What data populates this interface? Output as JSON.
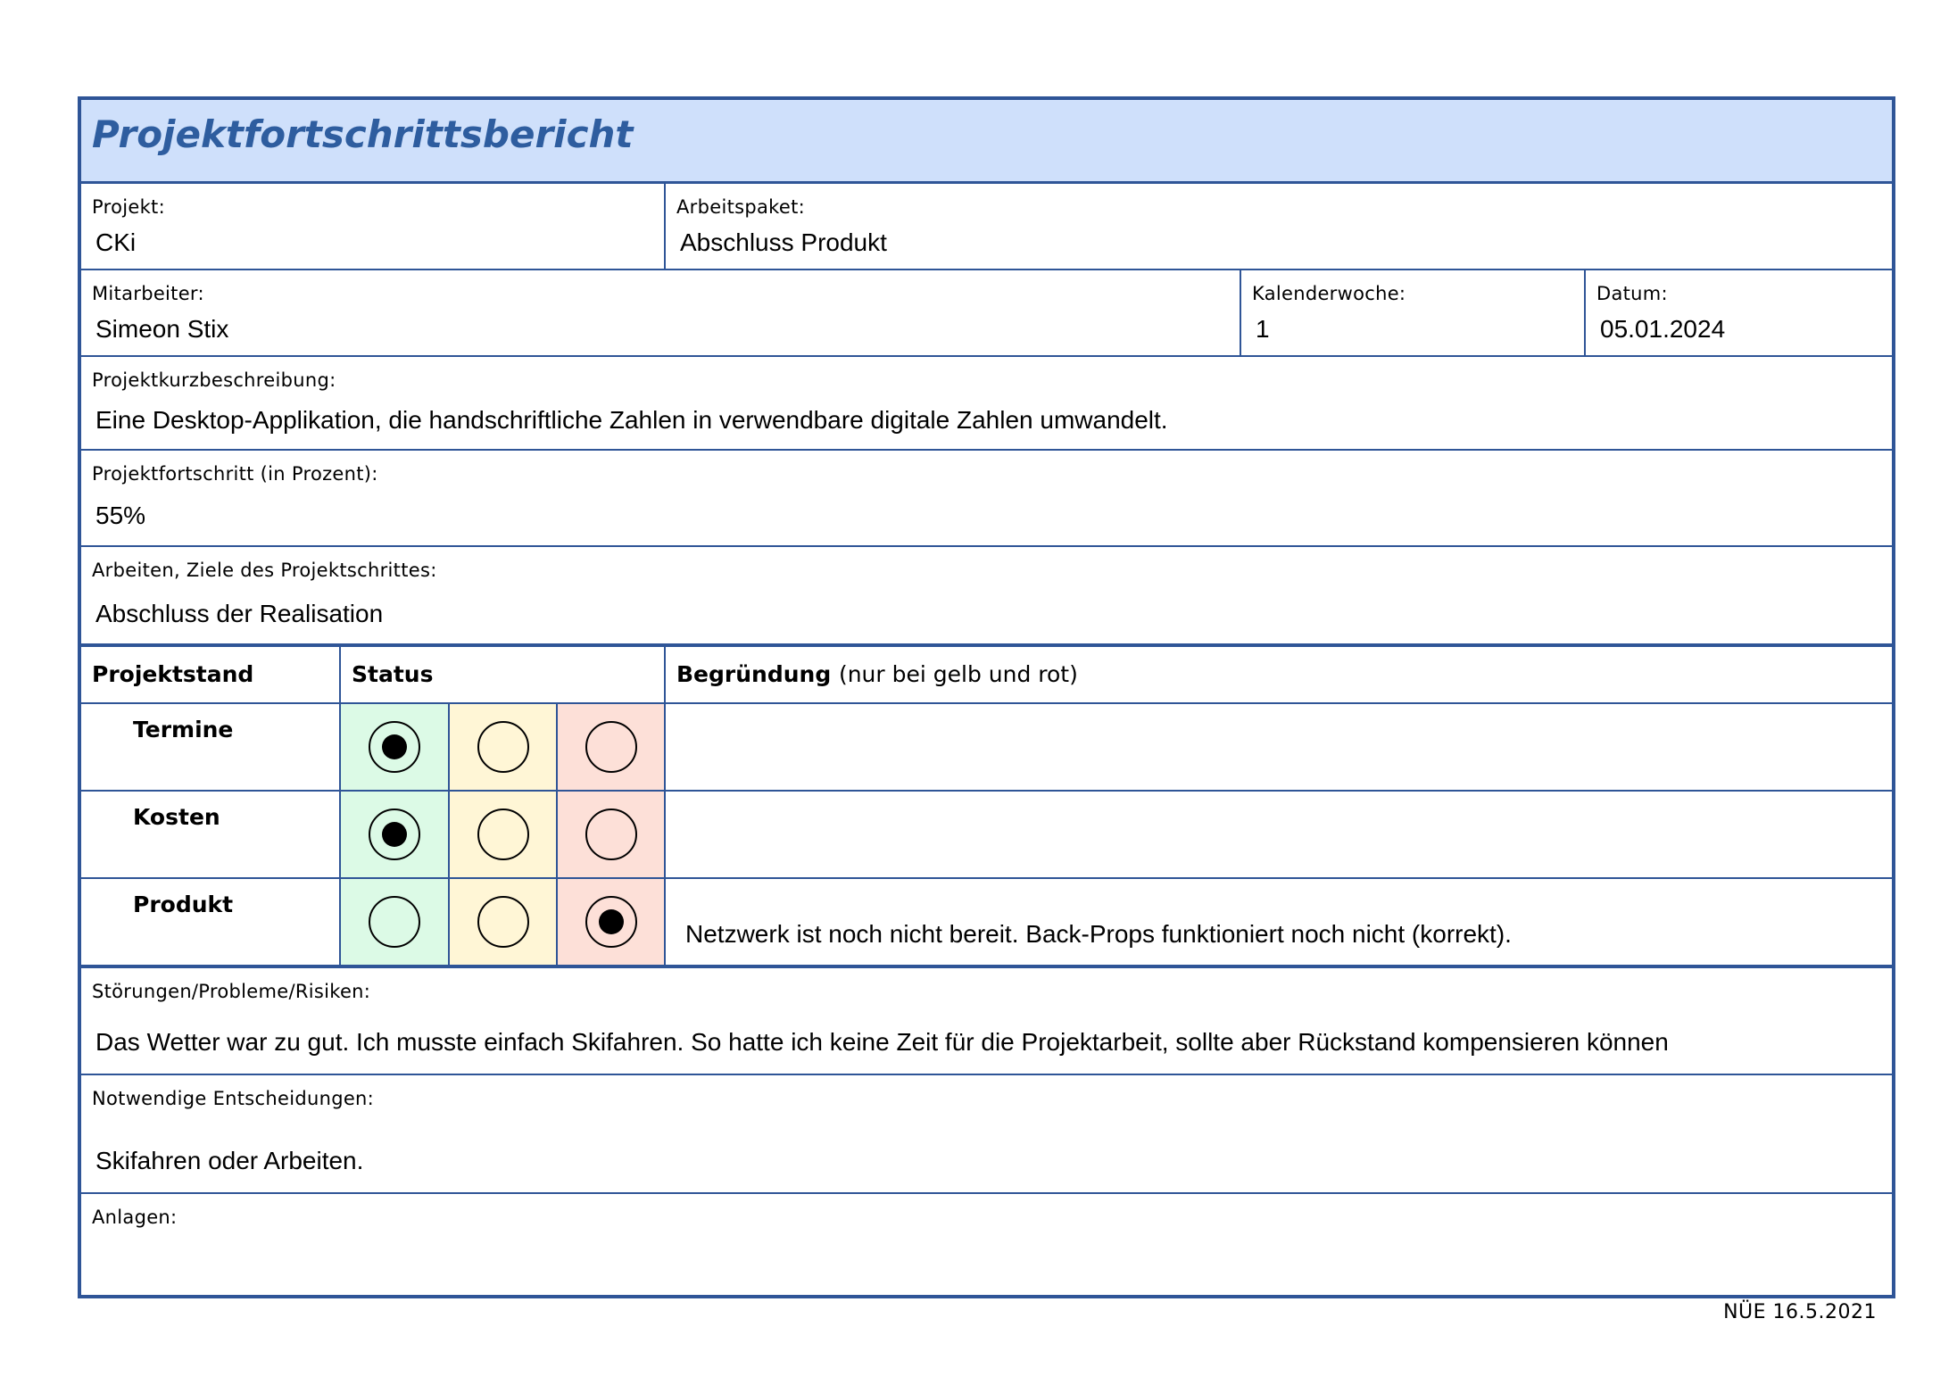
{
  "title": "Projektfortschrittsbericht",
  "colors": {
    "border": "#2f5597",
    "title_bg": "#cfe0fb",
    "title_text": "#2e5d9f",
    "green": "#dcfae6",
    "yellow": "#fff6d6",
    "red": "#fde0d8"
  },
  "projekt": {
    "label": "Projekt:",
    "value": "CKi"
  },
  "arbeitspaket": {
    "label": "Arbeitspaket:",
    "value": "Abschluss Produkt"
  },
  "mitarbeiter": {
    "label": "Mitarbeiter:",
    "value": "Simeon Stix"
  },
  "kalenderwoche": {
    "label": "Kalenderwoche:",
    "value": "1"
  },
  "datum": {
    "label": "Datum:",
    "value": "05.01.2024"
  },
  "kurzbeschreibung": {
    "label": "Projektkurzbeschreibung:",
    "value": "Eine Desktop-Applikation, die handschriftliche Zahlen in verwendbare digitale Zahlen umwandelt."
  },
  "fortschritt": {
    "label": "Projektfortschritt (in Prozent):",
    "value": "55%"
  },
  "ziele": {
    "label": "Arbeiten, Ziele des Projektschrittes:",
    "value": "Abschluss der Realisation"
  },
  "stand": {
    "header_projektstand": "Projektstand",
    "header_status": "Status",
    "header_begruendung": "Begründung",
    "header_begruendung_note": "(nur bei gelb und rot)",
    "rows": [
      {
        "name": "Termine",
        "selected": "green",
        "reason": ""
      },
      {
        "name": "Kosten",
        "selected": "green",
        "reason": ""
      },
      {
        "name": "Produkt",
        "selected": "red",
        "reason": "Netzwerk ist noch nicht bereit. Back-Props funktioniert noch nicht (korrekt)."
      }
    ]
  },
  "stoerungen": {
    "label": "Störungen/Probleme/Risiken:",
    "value": "Das Wetter war zu gut. Ich musste einfach Skifahren. So hatte ich keine Zeit für die Projektarbeit, sollte aber Rückstand kompensieren können"
  },
  "entscheidungen": {
    "label": "Notwendige Entscheidungen:",
    "value": "Skifahren oder Arbeiten."
  },
  "anlagen": {
    "label": "Anlagen:",
    "value": ""
  },
  "footer": "NÜE 16.5.2021"
}
